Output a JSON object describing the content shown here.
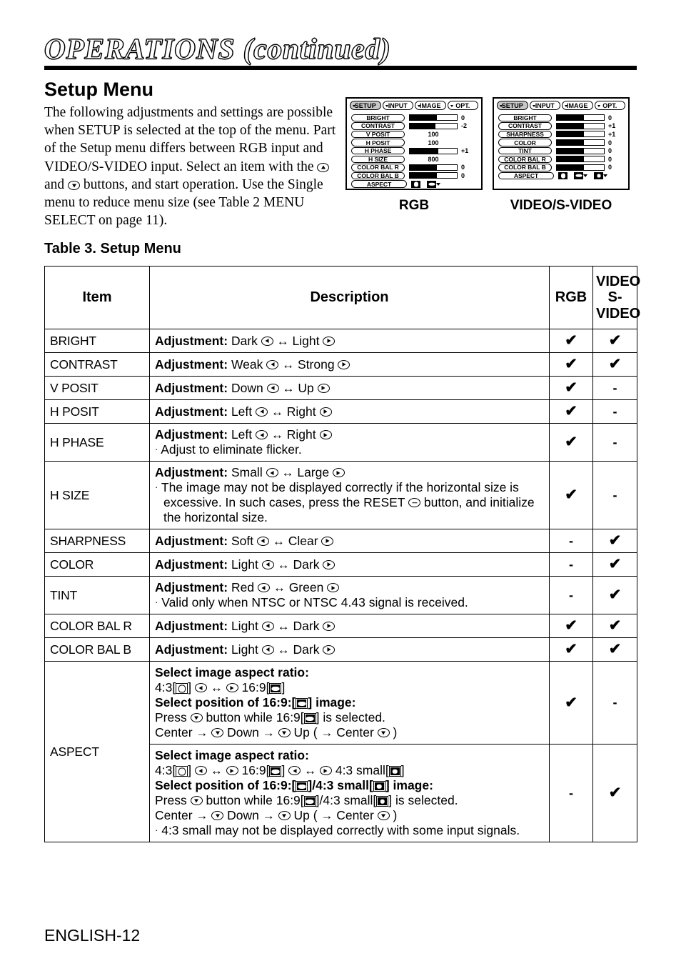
{
  "header": {
    "title": "OPERATIONS (continued)"
  },
  "section": {
    "heading": "Setup Menu",
    "intro": "The following adjustments and settings are possible when SETUP is selected at the top of the menu. Part of the Setup menu differs between RGB input and VIDEO/S-VIDEO input. Select an item with the",
    "intro_mid": "and",
    "intro_end": "buttons, and start operation. Use the Single menu to reduce menu size (see Table 2 MENU SELECT on page 11)."
  },
  "osd": {
    "tabs": [
      "SETUP",
      "INPUT",
      "IMAGE",
      "OPT."
    ],
    "selected_tab": "SETUP",
    "rgb": {
      "caption": "RGB",
      "rows": [
        {
          "label": "BRIGHT",
          "type": "bar",
          "fill": 57,
          "value": "0"
        },
        {
          "label": "CONTRAST",
          "type": "bar",
          "fill": 55,
          "value": "-2"
        },
        {
          "label": "V POSIT",
          "type": "num",
          "value": "100"
        },
        {
          "label": "H POSIT",
          "type": "num",
          "value": "100"
        },
        {
          "label": "H PHASE",
          "type": "bar",
          "fill": 60,
          "value": "+1"
        },
        {
          "label": "H SIZE",
          "type": "num",
          "value": "800"
        },
        {
          "label": "COLOR BAL R",
          "type": "bar",
          "fill": 57,
          "value": "0"
        },
        {
          "label": "COLOR BAL B",
          "type": "bar",
          "fill": 57,
          "value": "0"
        },
        {
          "label": "ASPECT",
          "type": "aspect",
          "icons": [
            "4:3",
            "16:9"
          ]
        }
      ]
    },
    "video": {
      "caption": "VIDEO/S-VIDEO",
      "rows": [
        {
          "label": "BRIGHT",
          "type": "bar",
          "fill": 57,
          "value": "0"
        },
        {
          "label": "CONTRAST",
          "type": "bar",
          "fill": 57,
          "value": "+1"
        },
        {
          "label": "SHARPNESS",
          "type": "bar",
          "fill": 57,
          "value": "+1"
        },
        {
          "label": "COLOR",
          "type": "bar",
          "fill": 57,
          "value": "0"
        },
        {
          "label": "TINT",
          "type": "bar",
          "fill": 57,
          "value": "0"
        },
        {
          "label": "COLOR BAL  R",
          "type": "bar",
          "fill": 57,
          "value": "0"
        },
        {
          "label": "COLOR BAL  B",
          "type": "bar",
          "fill": 57,
          "value": "0"
        },
        {
          "label": "ASPECT",
          "type": "aspect",
          "icons": [
            "4:3",
            "16:9",
            "4:3 small"
          ]
        }
      ]
    }
  },
  "table": {
    "caption": "Table 3. Setup Menu",
    "headers": {
      "item": "Item",
      "description": "Description",
      "rgb": "RGB",
      "video_line1": "VIDEO",
      "video_line2": "S-VIDEO"
    },
    "marks": {
      "check": "✔",
      "dash": "-"
    },
    "rows": [
      {
        "item": "BRIGHT",
        "adjustment_label": "Adjustment:",
        "left": "Dark",
        "right": "Light",
        "rgb": "check",
        "video": "check"
      },
      {
        "item": "CONTRAST",
        "adjustment_label": "Adjustment:",
        "left": "Weak",
        "right": "Strong",
        "rgb": "check",
        "video": "check"
      },
      {
        "item": "V POSIT",
        "adjustment_label": "Adjustment:",
        "left": "Down",
        "right": "Up",
        "rgb": "check",
        "video": "dash"
      },
      {
        "item": "H POSIT",
        "adjustment_label": "Adjustment:",
        "left": "Left",
        "right": "Right",
        "rgb": "check",
        "video": "dash"
      },
      {
        "item": "H PHASE",
        "adjustment_label": "Adjustment:",
        "left": "Left",
        "right": "Right",
        "note": "Adjust to eliminate flicker.",
        "rgb": "check",
        "video": "dash"
      },
      {
        "item": "H SIZE",
        "adjustment_label": "Adjustment:",
        "left": "Small",
        "right": "Large",
        "note_part1": "The image may not be displayed correctly if the horizontal size is excessive. In such cases, press the RESET",
        "note_part2": "button, and initialize the horizontal size.",
        "rgb": "check",
        "video": "dash"
      },
      {
        "item": "SHARPNESS",
        "adjustment_label": "Adjustment:",
        "left": "Soft",
        "right": "Clear",
        "rgb": "dash",
        "video": "check"
      },
      {
        "item": "COLOR",
        "adjustment_label": "Adjustment:",
        "left": "Light",
        "right": "Dark",
        "rgb": "dash",
        "video": "check"
      },
      {
        "item": "TINT",
        "adjustment_label": "Adjustment:",
        "left": "Red",
        "right": "Green",
        "note": "Valid only when NTSC or NTSC 4.43 signal is received.",
        "rgb": "dash",
        "video": "check"
      },
      {
        "item": "COLOR BAL R",
        "adjustment_label": "Adjustment:",
        "left": "Light",
        "right": "Dark",
        "rgb": "check",
        "video": "check"
      },
      {
        "item": "COLOR BAL B",
        "adjustment_label": "Adjustment:",
        "left": "Light",
        "right": "Dark",
        "rgb": "check",
        "video": "check"
      }
    ],
    "aspect": {
      "item": "ASPECT",
      "rgb_block": {
        "heading": "Select image aspect ratio:",
        "ratio_a": "4:3[",
        "ratio_a_end": "]",
        "ratio_b": "16:9[",
        "ratio_b_end": "]",
        "position_heading_a": "Select position of 16:9:[",
        "position_heading_b": "] image:",
        "press_a": "Press",
        "press_b": "button while 16:9[",
        "press_c": "] is selected.",
        "sequence_a": "Center",
        "sequence_b": "Down",
        "sequence_c": "Up (",
        "sequence_d": "Center",
        "sequence_e": ")",
        "rgb": "check",
        "video": "dash"
      },
      "video_block": {
        "heading": "Select image aspect ratio:",
        "ratio_a": "4:3[",
        "ratio_a_end": "]",
        "ratio_b": "16:9[",
        "ratio_b_end": "]",
        "ratio_c": "4:3 small[",
        "ratio_c_end": "]",
        "position_heading_a": "Select position of 16:9:[",
        "position_heading_b": "]/4:3 small[",
        "position_heading_c": "] image:",
        "press_a": "Press",
        "press_b": "button while 16:9[",
        "press_c": "]/4:3 small[",
        "press_d": "] is selected.",
        "sequence_a": "Center",
        "sequence_b": "Down",
        "sequence_c": "Up (",
        "sequence_d": "Center",
        "sequence_e": ")",
        "note": "4:3 small may not be displayed correctly with some input signals.",
        "rgb": "dash",
        "video": "check"
      }
    }
  },
  "footer": {
    "page_label": "ENGLISH-12"
  },
  "icons": {
    "up": "up-button-icon",
    "down": "down-button-icon",
    "left": "left-button-icon",
    "right": "right-button-icon",
    "reset": "reset-button-icon",
    "bidirectional": "↔",
    "arrow_right": "→",
    "bullet": "·"
  }
}
